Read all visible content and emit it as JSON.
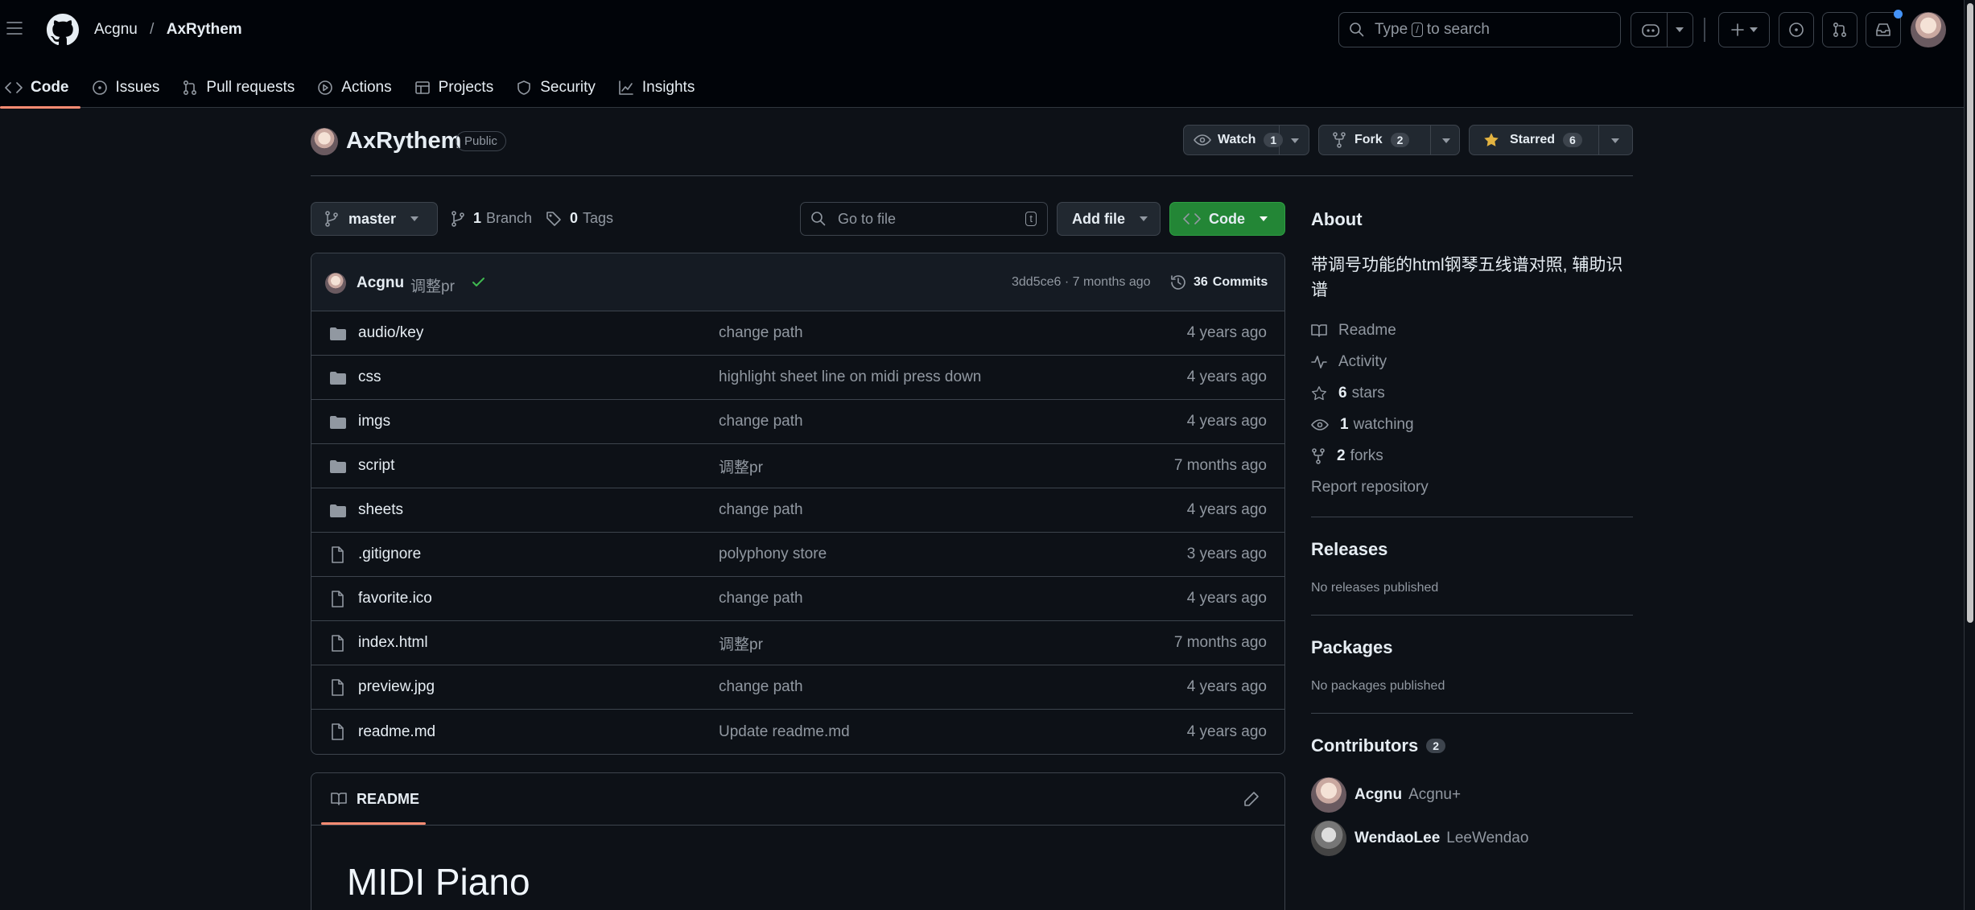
{
  "header": {
    "owner": "Acgnu",
    "slash": "/",
    "repo": "AxRythem",
    "search_prefix": "Type",
    "search_key": "/",
    "search_suffix": "to search"
  },
  "tabs": [
    {
      "label": "Code",
      "icon": "code-icon"
    },
    {
      "label": "Issues",
      "icon": "issue-icon"
    },
    {
      "label": "Pull requests",
      "icon": "pull-request-icon"
    },
    {
      "label": "Actions",
      "icon": "play-icon"
    },
    {
      "label": "Projects",
      "icon": "table-icon"
    },
    {
      "label": "Security",
      "icon": "shield-icon"
    },
    {
      "label": "Insights",
      "icon": "graph-icon"
    }
  ],
  "repo": {
    "name": "AxRythem",
    "visibility": "Public",
    "watch_label": "Watch",
    "watch_count": "1",
    "fork_label": "Fork",
    "fork_count": "2",
    "star_label": "Starred",
    "star_count": "6"
  },
  "toolbar": {
    "branch": "master",
    "branches_count": "1",
    "branches_label": "Branch",
    "tags_count": "0",
    "tags_label": "Tags",
    "goto_placeholder": "Go to file",
    "goto_key": "t",
    "add_file": "Add file",
    "code": "Code"
  },
  "last_commit": {
    "author": "Acgnu",
    "message": "调整pr",
    "hash_time": "3dd5ce6 · 7 months ago",
    "commits_count": "36",
    "commits_label": "Commits"
  },
  "files": [
    {
      "name": "audio/key",
      "message": "change path",
      "date": "4 years ago",
      "type": "folder"
    },
    {
      "name": "css",
      "message": "highlight sheet line on midi press down",
      "date": "4 years ago",
      "type": "folder"
    },
    {
      "name": "imgs",
      "message": "change path",
      "date": "4 years ago",
      "type": "folder"
    },
    {
      "name": "script",
      "message": "调整pr",
      "date": "7 months ago",
      "type": "folder"
    },
    {
      "name": "sheets",
      "message": "change path",
      "date": "4 years ago",
      "type": "folder"
    },
    {
      "name": ".gitignore",
      "message": "polyphony store",
      "date": "3 years ago",
      "type": "file"
    },
    {
      "name": "favorite.ico",
      "message": "change path",
      "date": "4 years ago",
      "type": "file"
    },
    {
      "name": "index.html",
      "message": "调整pr",
      "date": "7 months ago",
      "type": "file"
    },
    {
      "name": "preview.jpg",
      "message": "change path",
      "date": "4 years ago",
      "type": "file"
    },
    {
      "name": "readme.md",
      "message": "Update readme.md",
      "date": "4 years ago",
      "type": "file"
    }
  ],
  "readme": {
    "tab_label": "README",
    "heading": "MIDI Piano"
  },
  "about": {
    "title": "About",
    "description": "带调号功能的html钢琴五线谱对照, 辅助识谱",
    "readme": "Readme",
    "activity": "Activity",
    "stars_count": "6",
    "stars_label": "stars",
    "watching_count": "1",
    "watching_label": "watching",
    "forks_count": "2",
    "forks_label": "forks",
    "report": "Report repository"
  },
  "releases": {
    "title": "Releases",
    "empty": "No releases published"
  },
  "packages": {
    "title": "Packages",
    "empty": "No packages published"
  },
  "contributors": {
    "title": "Contributors",
    "count": "2",
    "list": [
      {
        "login": "Acgnu",
        "name": "Acgnu+"
      },
      {
        "login": "WendaoLee",
        "name": "LeeWendao"
      }
    ]
  },
  "colors": {
    "accent_green": "#238636",
    "underline": "#fd8c73",
    "star": "#e3b341",
    "check": "#3fb950"
  }
}
